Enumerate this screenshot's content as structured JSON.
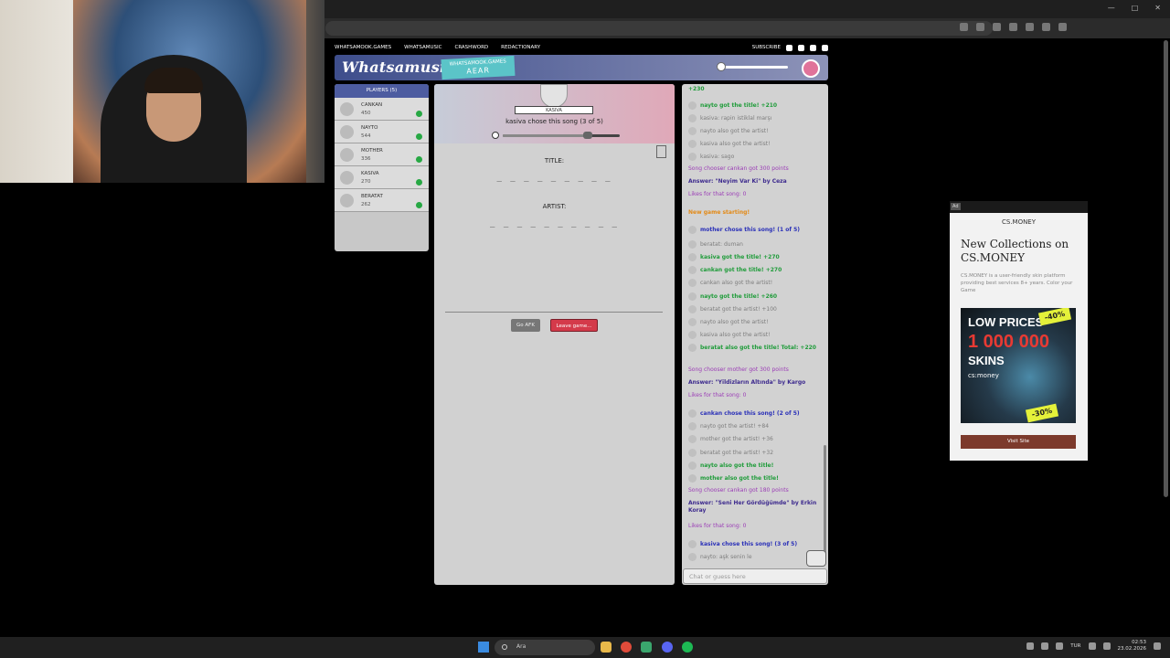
{
  "site": {
    "nav_links": [
      "WHATSAMOOK.GAMES",
      "WHATSAMUSIC",
      "CRASHWORD",
      "REDACTIONARY"
    ],
    "subscribe": "SUBSCRIBE",
    "logo": "Whatsamusic",
    "room_label": "WHATSAMOOK.GAMES",
    "room_code": "AEAR"
  },
  "players": {
    "header": "PLAYERS (5)",
    "list": [
      {
        "name": "CANKAN",
        "points": "450"
      },
      {
        "name": "NAYTO",
        "points": "544"
      },
      {
        "name": "MOTHER",
        "points": "336"
      },
      {
        "name": "KASIVA",
        "points": "270"
      },
      {
        "name": "BERATAT",
        "points": "262"
      }
    ]
  },
  "game": {
    "chooser_name": "KASIVA",
    "chooser_text": "kasiva chose this song (3 of 5)",
    "title_label": "TITLE:",
    "title_blanks": "_ _ _   _ _ _ _ _ _",
    "artist_label": "ARTIST:",
    "artist_blanks": "_ _ _ _ _   _ _ _ _ _",
    "afk_button": "Go AFK",
    "leave_button": "Leave game...",
    "progress_fraction": 0.73
  },
  "chat": {
    "messages": [
      {
        "text": "+230",
        "style": "c-green",
        "icon": false
      },
      {
        "text": "nayto got the title! +210",
        "style": "c-green",
        "icon": true
      },
      {
        "text": "kasiva: rapin istiklal marşı",
        "style": "c-grey",
        "icon": true
      },
      {
        "text": "nayto also got the artist!",
        "style": "c-grey",
        "icon": true
      },
      {
        "text": "kasiva also got the artist!",
        "style": "c-grey",
        "icon": true
      },
      {
        "text": "kasiva: sago",
        "style": "c-grey",
        "icon": true
      },
      {
        "text": "Song chooser cankan got 300 points",
        "style": "c-purple",
        "icon": false
      },
      {
        "text": "Answer: \"Neyim Var Ki\" by Ceza",
        "style": "c-answer",
        "icon": false
      },
      {
        "text": "Likes for that song: 0",
        "style": "c-purple",
        "icon": false
      },
      {
        "text": "New game starting!",
        "style": "c-orange",
        "icon": false
      },
      {
        "text": "mother chose this song! (1 of 5)",
        "style": "c-blue",
        "icon": true
      },
      {
        "text": "beratat: duman",
        "style": "c-grey",
        "icon": true
      },
      {
        "text": "kasiva got the title! +270",
        "style": "c-green",
        "icon": true
      },
      {
        "text": "cankan got the title! +270",
        "style": "c-green",
        "icon": true
      },
      {
        "text": "cankan also got the artist!",
        "style": "c-grey",
        "icon": true
      },
      {
        "text": "nayto got the title! +260",
        "style": "c-green",
        "icon": true
      },
      {
        "text": "beratat got the artist! +100",
        "style": "c-grey",
        "icon": true
      },
      {
        "text": "nayto also got the artist!",
        "style": "c-grey",
        "icon": true
      },
      {
        "text": "kasiva also got the artist!",
        "style": "c-grey",
        "icon": true
      },
      {
        "text": "beratat also got the title! Total: +220",
        "style": "c-green",
        "icon": true
      },
      {
        "text": "Song chooser mother got 300 points",
        "style": "c-purple",
        "icon": false
      },
      {
        "text": "Answer: \"Yildizların Altında\" by Kargo",
        "style": "c-answer",
        "icon": false
      },
      {
        "text": "Likes for that song: 0",
        "style": "c-purple",
        "icon": false
      },
      {
        "text": "cankan chose this song! (2 of 5)",
        "style": "c-blue",
        "icon": true
      },
      {
        "text": "nayto got the artist! +84",
        "style": "c-grey",
        "icon": true
      },
      {
        "text": "mother got the artist! +36",
        "style": "c-grey",
        "icon": true
      },
      {
        "text": "beratat got the artist! +32",
        "style": "c-grey",
        "icon": true
      },
      {
        "text": "nayto also got the title!",
        "style": "c-green",
        "icon": true
      },
      {
        "text": "mother also got the title!",
        "style": "c-green",
        "icon": true
      },
      {
        "text": "Song chooser cankan got 180 points",
        "style": "c-purple",
        "icon": false
      },
      {
        "text": "Answer: \"Seni Her Gördüğümde\" by Erkin Koray",
        "style": "c-answer",
        "icon": false
      },
      {
        "text": "Likes for that song: 0",
        "style": "c-purple",
        "icon": false
      },
      {
        "text": "kasiva chose this song! (3 of 5)",
        "style": "c-blue",
        "icon": true
      },
      {
        "text": "nayto: aşk senin le",
        "style": "c-grey",
        "icon": true
      }
    ],
    "input_placeholder": "Chat or guess here"
  },
  "ad": {
    "tag": "Ad",
    "brand": "CS.MONEY",
    "title": "New Collections on CS.MONEY",
    "desc": "CS.MONEY is a user-friendly skin platform providing best services 8+ years. Color your Game",
    "img_low": "LOW PRICES",
    "img_big": "1 000 000",
    "img_skins": "SKINS",
    "img_cs": "cs:money",
    "badge1": "-40%",
    "badge2": "-30%",
    "button": "Visit Site"
  },
  "taskbar": {
    "search": "Ara",
    "lang": "TUR",
    "time": "02:53",
    "date": "23.02.2026"
  }
}
